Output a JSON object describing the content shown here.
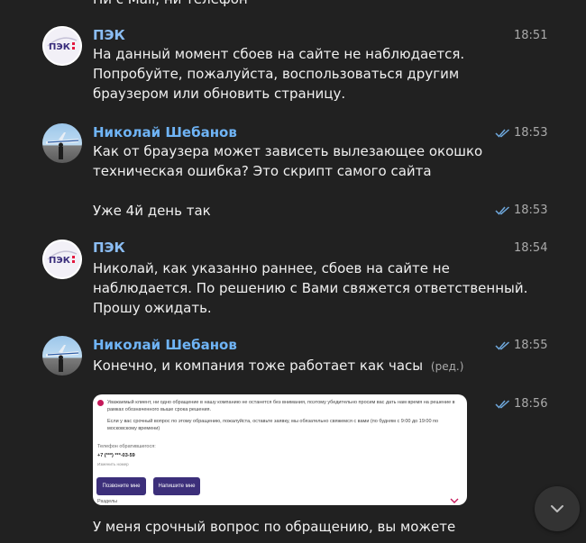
{
  "partial_top_text": "Ни с Mail, ни телефон",
  "messages": [
    {
      "sender": "ПЭК",
      "time": "18:51",
      "lines": [
        "На данный момент сбоев на сайте не наблюдается.",
        "Попробуйте, пожалуйста, воспользоваться другим",
        "браузером или обновить страницу."
      ]
    },
    {
      "sender": "Николай Шебанов",
      "time": "18:53",
      "lines": [
        "Как от браузера может зависеть вылезающее окошко",
        "техническая ошибка? Это скрипт самого сайта"
      ]
    },
    {
      "time": "18:53",
      "lines": [
        "Уже 4й день так"
      ]
    },
    {
      "sender": "ПЭК",
      "time": "18:54",
      "lines": [
        "Николай, как указанно раннее, сбоев на сайте не",
        "наблюдается. По решению с Вами свяжется ответственный.",
        "Прошу ожидать."
      ]
    },
    {
      "sender": "Николай Шебанов",
      "time": "18:55",
      "lines": [
        "Конечно, и компания тоже работает как часы"
      ],
      "edited": "(ред.)"
    },
    {
      "time": "18:56",
      "image": {
        "notice": "Уважаемый клиент, ни одно обращение в нашу компанию не останется без внимания, поэтому убедительно просим вас дать нам время на решение в рамках обозначенного выше срока решения.",
        "urgent": "Если у вас срочный вопрос по этому обращению, пожалуйста, оставьте заявку, мы обязательно свяжемся с вами (по будням с 9:00 до 19:00 по московскому времени)",
        "phone_label": "Телефон обратившегося:",
        "phone_value": "+7 (***) ***-03-59",
        "change_link": "Изменить номер",
        "call_button": "Позвоните мне",
        "write_button": "Напишите мне",
        "sections": "Разделы"
      }
    },
    {
      "lines": [
        "У меня срочный вопрос по обращению, вы можете"
      ]
    }
  ],
  "avatars": {
    "pek_logo_text": "ПЭК"
  },
  "colors": {
    "background": "#212121",
    "pek_name": "#8bbdf3",
    "user_name": "#6fb4f6",
    "read_check": "#6fa8dc",
    "card_button": "#3c2f7a"
  },
  "scroll_down_button_icon": "chevron-down-icon"
}
